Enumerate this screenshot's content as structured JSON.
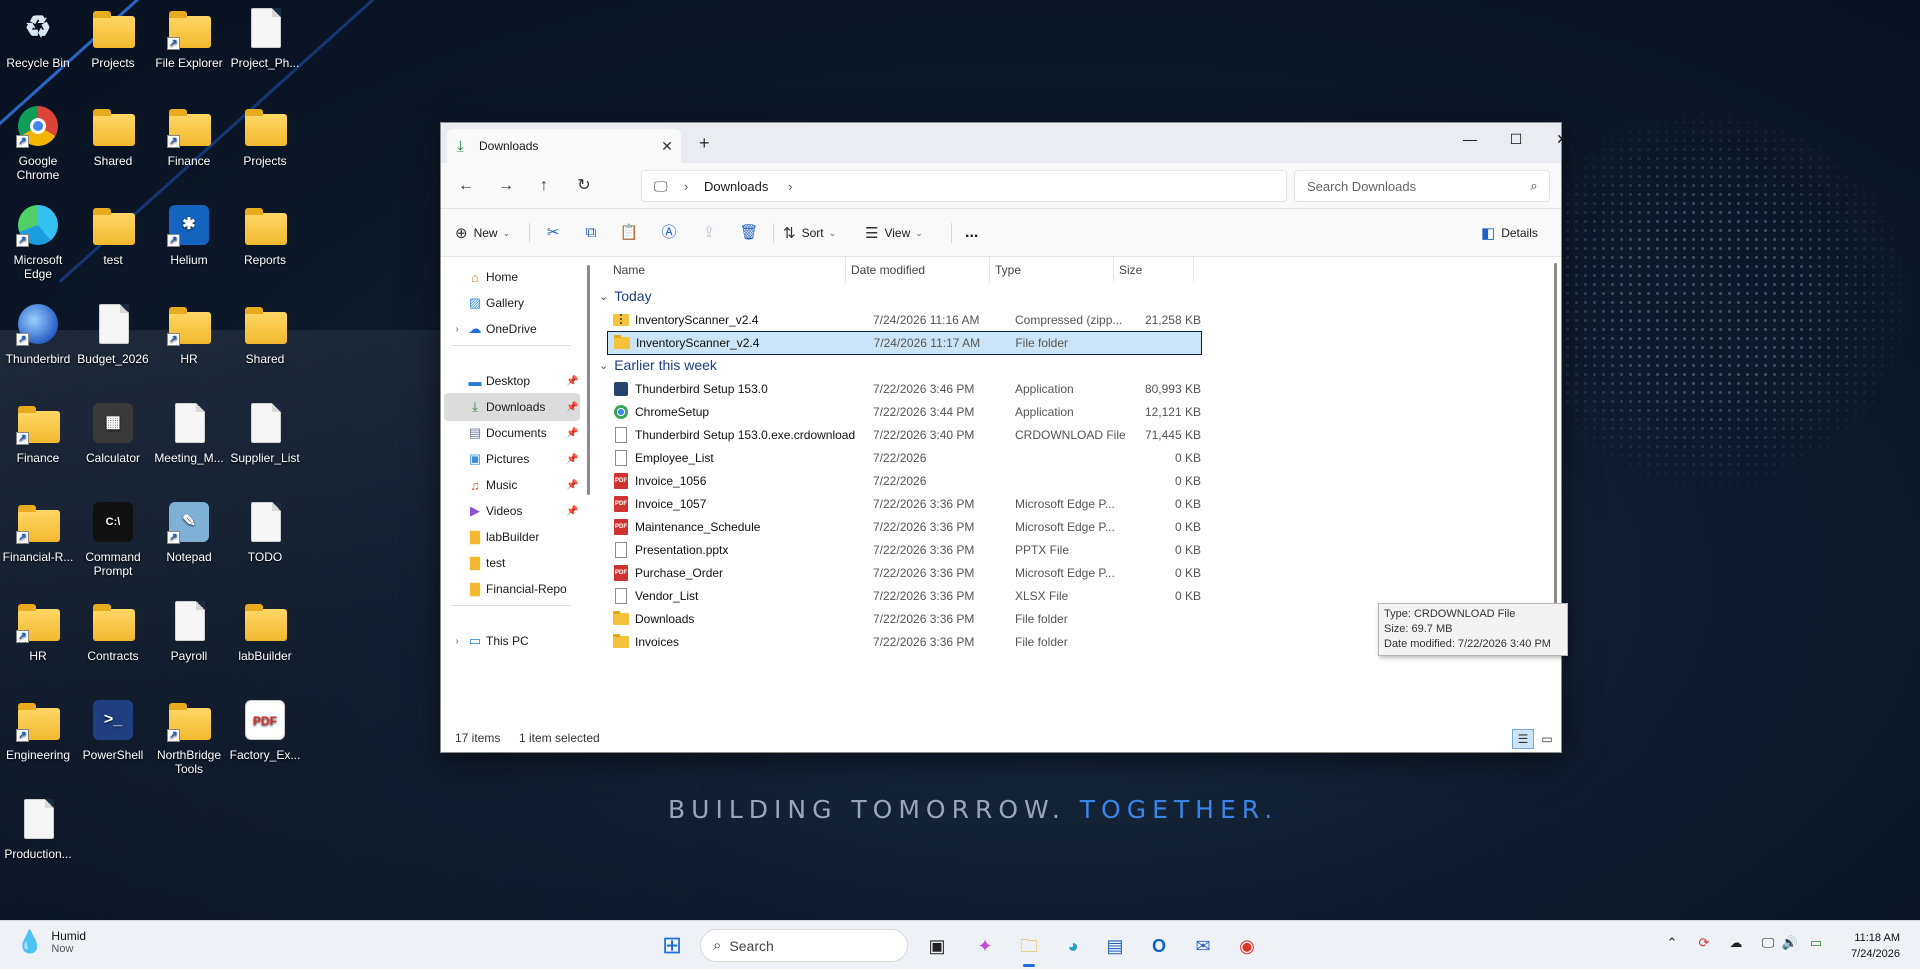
{
  "wallpaper": {
    "tagline_main": "BUILDING TOMORROW.",
    "tagline_accent": "TOGETHER",
    "tagline_dot": "."
  },
  "desktop_icons": [
    {
      "label": "Recycle Bin",
      "icon": "recycle-bin-icon"
    },
    {
      "label": "Projects",
      "icon": "folder-icon"
    },
    {
      "label": "File Explorer",
      "icon": "folder-icon"
    },
    {
      "label": "Project_Ph...",
      "icon": "document-icon"
    },
    {
      "label": "Google Chrome",
      "icon": "chrome-icon"
    },
    {
      "label": "Shared",
      "icon": "folder-icon"
    },
    {
      "label": "Finance",
      "icon": "folder-icon"
    },
    {
      "label": "Projects",
      "icon": "folder-icon"
    },
    {
      "label": "Microsoft Edge",
      "icon": "edge-icon"
    },
    {
      "label": "test",
      "icon": "folder-icon"
    },
    {
      "label": "Helium",
      "icon": "helium-icon"
    },
    {
      "label": "Reports",
      "icon": "folder-icon"
    },
    {
      "label": "Thunderbird",
      "icon": "thunderbird-icon"
    },
    {
      "label": "Budget_2026",
      "icon": "document-icon"
    },
    {
      "label": "HR",
      "icon": "folder-icon"
    },
    {
      "label": "Shared",
      "icon": "folder-icon"
    },
    {
      "label": "Finance",
      "icon": "folder-icon"
    },
    {
      "label": "Calculator",
      "icon": "calculator-icon"
    },
    {
      "label": "Meeting_M...",
      "icon": "document-icon"
    },
    {
      "label": "Supplier_List",
      "icon": "document-icon"
    },
    {
      "label": "Financial-R...",
      "icon": "folder-icon"
    },
    {
      "label": "Command Prompt",
      "icon": "command-prompt-icon"
    },
    {
      "label": "Notepad",
      "icon": "notepad-icon"
    },
    {
      "label": "TODO",
      "icon": "document-icon"
    },
    {
      "label": "HR",
      "icon": "folder-icon"
    },
    {
      "label": "Contracts",
      "icon": "folder-icon"
    },
    {
      "label": "Payroll",
      "icon": "document-icon"
    },
    {
      "label": "labBuilder",
      "icon": "folder-icon"
    },
    {
      "label": "Engineering",
      "icon": "folder-icon"
    },
    {
      "label": "PowerShell",
      "icon": "powershell-icon"
    },
    {
      "label": "NorthBridge Tools",
      "icon": "folder-icon"
    },
    {
      "label": "Factory_Ex...",
      "icon": "pdf-icon"
    },
    {
      "label": "Production...",
      "icon": "document-icon"
    }
  ],
  "explorer": {
    "tab_title": "Downloads",
    "breadcrumb": [
      "Downloads"
    ],
    "search_placeholder": "Search Downloads",
    "commands": {
      "new": "New",
      "sort": "Sort",
      "view": "View",
      "more": "...",
      "details": "Details"
    },
    "nav_pane": [
      {
        "label": "Home",
        "icon": "home-icon",
        "pinned": false
      },
      {
        "label": "Gallery",
        "icon": "gallery-icon",
        "pinned": false
      },
      {
        "label": "OneDrive",
        "icon": "onedrive-icon",
        "pinned": false
      },
      {
        "label": "Desktop",
        "icon": "desktop-icon",
        "pinned": true
      },
      {
        "label": "Downloads",
        "icon": "download-icon",
        "pinned": true
      },
      {
        "label": "Documents",
        "icon": "documents-icon",
        "pinned": true
      },
      {
        "label": "Pictures",
        "icon": "pictures-icon",
        "pinned": true
      },
      {
        "label": "Music",
        "icon": "music-icon",
        "pinned": true
      },
      {
        "label": "Videos",
        "icon": "videos-icon",
        "pinned": true
      },
      {
        "label": "labBuilder",
        "icon": "folder-icon",
        "pinned": false
      },
      {
        "label": "test",
        "icon": "folder-icon",
        "pinned": false
      },
      {
        "label": "Financial-Repor",
        "icon": "folder-icon",
        "pinned": false
      },
      {
        "label": "This PC",
        "icon": "pc-icon",
        "pinned": false
      }
    ],
    "columns": [
      "Name",
      "Date modified",
      "Type",
      "Size"
    ],
    "groups": [
      {
        "title": "Today",
        "files": [
          {
            "name": "InventoryScanner_v2.4",
            "date": "7/24/2026 11:16 AM",
            "type": "Compressed (zipp...",
            "size": "21,258 KB",
            "icon": "zip"
          },
          {
            "name": "InventoryScanner_v2.4",
            "date": "7/24/2026 11:17 AM",
            "type": "File folder",
            "size": "",
            "icon": "folder",
            "selected": true
          }
        ]
      },
      {
        "title": "Earlier this week",
        "files": [
          {
            "name": "Thunderbird Setup 153.0",
            "date": "7/22/2026 3:46 PM",
            "type": "Application",
            "size": "80,993 KB",
            "icon": "app"
          },
          {
            "name": "ChromeSetup",
            "date": "7/22/2026 3:44 PM",
            "type": "Application",
            "size": "12,121 KB",
            "icon": "chrome"
          },
          {
            "name": "Thunderbird Setup 153.0.exe.crdownload",
            "date": "7/22/2026 3:40 PM",
            "type": "CRDOWNLOAD File",
            "size": "71,445 KB",
            "icon": "doc"
          },
          {
            "name": "Employee_List",
            "date": "7/22/2026",
            "type": "",
            "size": "0 KB",
            "icon": "doc"
          },
          {
            "name": "Invoice_1056",
            "date": "7/22/2026",
            "type": "",
            "size": "0 KB",
            "icon": "pdf"
          },
          {
            "name": "Invoice_1057",
            "date": "7/22/2026 3:36 PM",
            "type": "Microsoft Edge P...",
            "size": "0 KB",
            "icon": "pdf"
          },
          {
            "name": "Maintenance_Schedule",
            "date": "7/22/2026 3:36 PM",
            "type": "Microsoft Edge P...",
            "size": "0 KB",
            "icon": "pdf"
          },
          {
            "name": "Presentation.pptx",
            "date": "7/22/2026 3:36 PM",
            "type": "PPTX File",
            "size": "0 KB",
            "icon": "doc"
          },
          {
            "name": "Purchase_Order",
            "date": "7/22/2026 3:36 PM",
            "type": "Microsoft Edge P...",
            "size": "0 KB",
            "icon": "pdf"
          },
          {
            "name": "Vendor_List",
            "date": "7/22/2026 3:36 PM",
            "type": "XLSX File",
            "size": "0 KB",
            "icon": "doc"
          },
          {
            "name": "Downloads",
            "date": "7/22/2026 3:36 PM",
            "type": "File folder",
            "size": "",
            "icon": "folder"
          },
          {
            "name": "Invoices",
            "date": "7/22/2026 3:36 PM",
            "type": "File folder",
            "size": "",
            "icon": "folder"
          }
        ]
      }
    ],
    "tooltip": {
      "line1": "Type: CRDOWNLOAD File",
      "line2": "Size: 69.7 MB",
      "line3": "Date modified: 7/22/2026 3:40 PM"
    },
    "status": {
      "items": "17 items",
      "selected": "1 item selected"
    }
  },
  "taskbar": {
    "weather_title": "Humid",
    "weather_sub": "Now",
    "search_placeholder": "Search",
    "time": "11:18 AM",
    "date": "7/24/2026"
  }
}
